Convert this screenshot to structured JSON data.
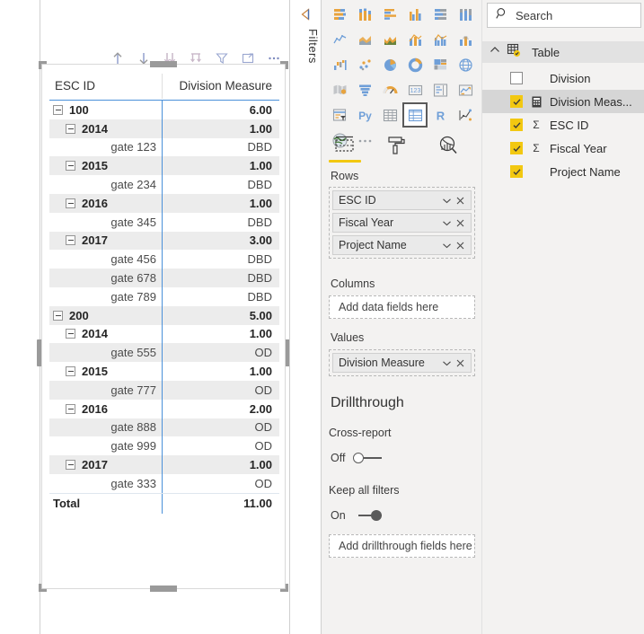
{
  "canvas": {
    "toolbar": [
      {
        "name": "drill-up-icon",
        "label": "Drill up"
      },
      {
        "name": "drill-down-icon",
        "label": "Drill down"
      },
      {
        "name": "expand-all-down-icon",
        "label": "Expand all down one level in the hierarchy"
      },
      {
        "name": "drill-down-hierarchy-icon",
        "label": "Go to the next level in the hierarchy"
      },
      {
        "name": "filter-icon",
        "label": "Filters"
      },
      {
        "name": "focus-mode-icon",
        "label": "Focus mode"
      },
      {
        "name": "more-options-icon",
        "label": "More options"
      }
    ]
  },
  "matrix": {
    "columns": [
      "ESC ID",
      "Division Measure"
    ],
    "rows": [
      {
        "level": 0,
        "label": "100",
        "value": "6.00",
        "bold": true,
        "expander": true,
        "banded": false
      },
      {
        "level": 1,
        "label": "2014",
        "value": "1.00",
        "bold": true,
        "expander": true,
        "banded": true
      },
      {
        "level": 2,
        "label": "gate 123",
        "value": "DBD",
        "bold": false,
        "expander": false,
        "banded": false
      },
      {
        "level": 1,
        "label": "2015",
        "value": "1.00",
        "bold": true,
        "expander": true,
        "banded": true
      },
      {
        "level": 2,
        "label": "gate 234",
        "value": "DBD",
        "bold": false,
        "expander": false,
        "banded": false
      },
      {
        "level": 1,
        "label": "2016",
        "value": "1.00",
        "bold": true,
        "expander": true,
        "banded": true
      },
      {
        "level": 2,
        "label": "gate 345",
        "value": "DBD",
        "bold": false,
        "expander": false,
        "banded": false
      },
      {
        "level": 1,
        "label": "2017",
        "value": "3.00",
        "bold": true,
        "expander": true,
        "banded": true
      },
      {
        "level": 2,
        "label": "gate 456",
        "value": "DBD",
        "bold": false,
        "expander": false,
        "banded": false
      },
      {
        "level": 2,
        "label": "gate 678",
        "value": "DBD",
        "bold": false,
        "expander": false,
        "banded": true
      },
      {
        "level": 2,
        "label": "gate 789",
        "value": "DBD",
        "bold": false,
        "expander": false,
        "banded": false
      },
      {
        "level": 0,
        "label": "200",
        "value": "5.00",
        "bold": true,
        "expander": true,
        "banded": true
      },
      {
        "level": 1,
        "label": "2014",
        "value": "1.00",
        "bold": true,
        "expander": true,
        "banded": false
      },
      {
        "level": 2,
        "label": "gate 555",
        "value": "OD",
        "bold": false,
        "expander": false,
        "banded": true
      },
      {
        "level": 1,
        "label": "2015",
        "value": "1.00",
        "bold": true,
        "expander": true,
        "banded": false
      },
      {
        "level": 2,
        "label": "gate 777",
        "value": "OD",
        "bold": false,
        "expander": false,
        "banded": true
      },
      {
        "level": 1,
        "label": "2016",
        "value": "2.00",
        "bold": true,
        "expander": true,
        "banded": false
      },
      {
        "level": 2,
        "label": "gate 888",
        "value": "OD",
        "bold": false,
        "expander": false,
        "banded": true
      },
      {
        "level": 2,
        "label": "gate 999",
        "value": "OD",
        "bold": false,
        "expander": false,
        "banded": false
      },
      {
        "level": 1,
        "label": "2017",
        "value": "1.00",
        "bold": true,
        "expander": true,
        "banded": true
      },
      {
        "level": 2,
        "label": "gate 333",
        "value": "OD",
        "bold": false,
        "expander": false,
        "banded": false
      }
    ],
    "total": {
      "label": "Total",
      "value": "11.00"
    }
  },
  "filters_pane": {
    "label": "Filters",
    "expand_icon": "expand-left-icon"
  },
  "visualizations": {
    "icons": [
      "stacked-bar-chart-icon",
      "stacked-column-chart-icon",
      "clustered-bar-chart-icon",
      "clustered-column-chart-icon",
      "100-stacked-bar-chart-icon",
      "100-stacked-column-chart-icon",
      "line-chart-icon",
      "area-chart-icon",
      "stacked-area-chart-icon",
      "line-stacked-column-chart-icon",
      "line-clustered-column-chart-icon",
      "ribbon-chart-icon",
      "waterfall-chart-icon",
      "scatter-chart-icon",
      "pie-chart-icon",
      "donut-chart-icon",
      "treemap-icon",
      "map-icon",
      "filled-map-icon",
      "funnel-chart-icon",
      "gauge-chart-icon",
      "card-icon",
      "multi-row-card-icon",
      "kpi-icon",
      "slicer-icon",
      "python-visual-icon",
      "table-icon",
      "matrix-icon",
      "r-script-visual-icon",
      "key-influencers-icon",
      "arcgis-map-icon",
      "more-visuals-icon"
    ],
    "selected": "matrix-icon",
    "tabs": [
      {
        "name": "fields-tab",
        "label": "Fields",
        "active": true
      },
      {
        "name": "format-tab",
        "label": "Format",
        "active": false
      },
      {
        "name": "analytics-tab",
        "label": "Analytics",
        "active": false
      }
    ],
    "wells": {
      "rows": {
        "label": "Rows",
        "chips": [
          "ESC ID",
          "Fiscal Year",
          "Project Name"
        ]
      },
      "columns": {
        "label": "Columns",
        "placeholder": "Add data fields here"
      },
      "values": {
        "label": "Values",
        "chips": [
          "Division Measure"
        ]
      }
    },
    "drillthrough": {
      "title": "Drillthrough",
      "cross_report": {
        "label": "Cross-report",
        "state": "Off",
        "on": false
      },
      "keep_all_filters": {
        "label": "Keep all filters",
        "state": "On",
        "on": true
      },
      "placeholder": "Add drillthrough fields here"
    }
  },
  "fields_pane": {
    "search": {
      "placeholder": "Search",
      "value": "",
      "icon": "search-icon"
    },
    "table": {
      "name": "Table",
      "expanded": true,
      "checked": true,
      "chevron": "chevron-up-icon"
    },
    "fields": [
      {
        "name": "Division",
        "checked": false,
        "type": "",
        "highlight": false
      },
      {
        "name": "Division Meas...",
        "checked": true,
        "type": "measure",
        "highlight": true
      },
      {
        "name": "ESC ID",
        "checked": true,
        "type": "sum",
        "highlight": false
      },
      {
        "name": "Fiscal Year",
        "checked": true,
        "type": "sum",
        "highlight": false
      },
      {
        "name": "Project Name",
        "checked": true,
        "type": "",
        "highlight": false
      }
    ]
  },
  "colors": {
    "accent_yellow": "#F2C811",
    "divider_blue": "#4A90D9",
    "pane_bg": "#F3F2F1",
    "band": "#ECECEC",
    "highlight": "#D6D6D6"
  }
}
